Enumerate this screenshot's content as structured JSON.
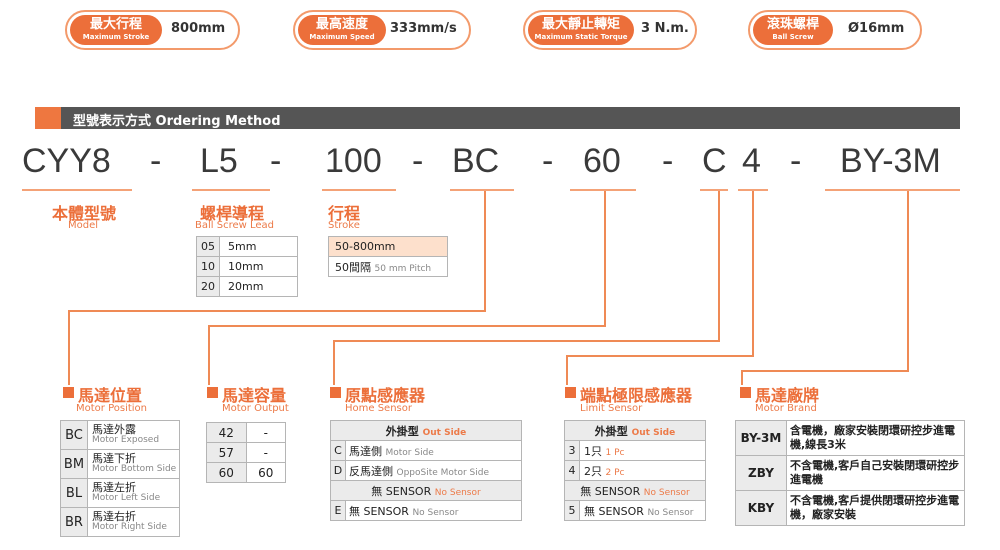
{
  "specs": [
    {
      "zh": "最大行程",
      "en": "Maximum Stroke",
      "value": "800mm"
    },
    {
      "zh": "最高速度",
      "en": "Maximum Speed",
      "value": "333mm/s"
    },
    {
      "zh": "最大靜止轉矩",
      "en": "Maximum Static Torque",
      "value": "3 N.m."
    },
    {
      "zh": "滾珠螺桿",
      "en": "Ball Screw",
      "value": "Ø16mm"
    }
  ],
  "header": "型號表示方式  Ordering Method",
  "code": {
    "p1": "CYY8",
    "p2": "L5",
    "p3": "100",
    "p4": "BC",
    "p5": "60",
    "p6": "C",
    "p7": "4",
    "p8": "BY-3M",
    "dash": "-"
  },
  "model": {
    "zh": "本體型號",
    "en": "Model"
  },
  "lead": {
    "zh": "螺桿導程",
    "en": "Ball Screw Lead",
    "rows": [
      {
        "c": "05",
        "v": "5mm"
      },
      {
        "c": "10",
        "v": "10mm"
      },
      {
        "c": "20",
        "v": "20mm"
      }
    ]
  },
  "stroke": {
    "zh": "行程",
    "en": "Stroke",
    "r1": "50-800mm",
    "r2zh": "50間隔",
    "r2en": "50 mm Pitch"
  },
  "position": {
    "zh": "馬達位置",
    "en": "Motor Position",
    "rows": [
      {
        "c": "BC",
        "zh": "馬達外露",
        "en": "Motor Exposed"
      },
      {
        "c": "BM",
        "zh": "馬達下折",
        "en": "Motor Bottom Side"
      },
      {
        "c": "BL",
        "zh": "馬達左折",
        "en": "Motor Left Side"
      },
      {
        "c": "BR",
        "zh": "馬達右折",
        "en": "Motor Right Side"
      }
    ]
  },
  "output": {
    "zh": "馬達容量",
    "en": "Motor Output",
    "rows": [
      {
        "c": "42",
        "v": "-"
      },
      {
        "c": "57",
        "v": "-"
      },
      {
        "c": "60",
        "v": "60"
      }
    ]
  },
  "home": {
    "zh": "原點感應器",
    "en": "Home Sensor",
    "h_zh": "外掛型",
    "h_en": "Out Side",
    "rows": [
      {
        "c": "C",
        "zh": "馬達側",
        "en": "Motor Side"
      },
      {
        "c": "D",
        "zh": "反馬達側",
        "en": "OppoSite Motor Side"
      }
    ],
    "ns_zh": "無 SENSOR",
    "ns_en": "No Sensor",
    "e_c": "E",
    "e_zh": "無 SENSOR",
    "e_en": "No Sensor"
  },
  "limit": {
    "zh": "端點極限感應器",
    "en": "Limit Sensor",
    "h_zh": "外掛型",
    "h_en": "Out Side",
    "rows": [
      {
        "c": "3",
        "zh": "1只",
        "en": "1 Pc"
      },
      {
        "c": "4",
        "zh": "2只",
        "en": "2 Pc"
      }
    ],
    "ns_zh": "無 SENSOR",
    "ns_en": "No Sensor",
    "f_c": "5",
    "f_zh": "無 SENSOR",
    "f_en": "No Sensor"
  },
  "brand": {
    "zh": "馬達廠牌",
    "en": "Motor Brand",
    "rows": [
      {
        "c": "BY-3M",
        "t": "含電機，廠家安裝閉環研控步進電機,線長3米"
      },
      {
        "c": "ZBY",
        "t": "不含電機,客戶自己安裝閉環研控步進電機"
      },
      {
        "c": "KBY",
        "t": "不含電機,客戶提供閉環研控步進電機，廠家安裝"
      }
    ]
  },
  "colors": {
    "accent": "#ec6f3a",
    "bar": "#555555"
  }
}
